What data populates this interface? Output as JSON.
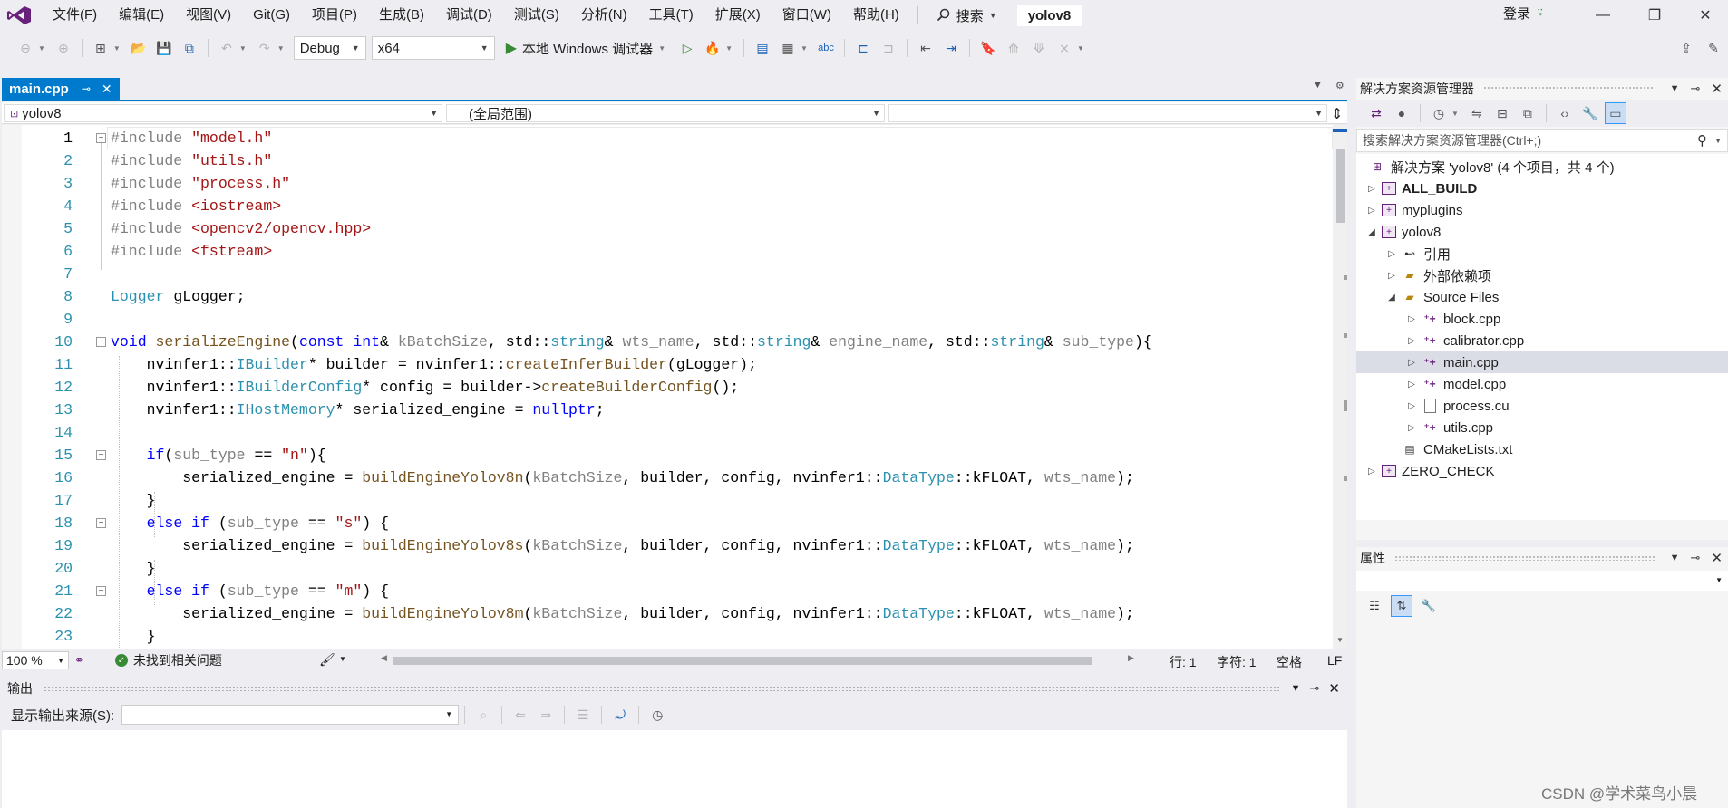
{
  "menubar": {
    "items": [
      "文件(F)",
      "编辑(E)",
      "视图(V)",
      "Git(G)",
      "项目(P)",
      "生成(B)",
      "调试(D)",
      "测试(S)",
      "分析(N)",
      "工具(T)",
      "扩展(X)",
      "窗口(W)",
      "帮助(H)"
    ],
    "search_label": "搜索",
    "project_name": "yolov8",
    "login_label": "登录"
  },
  "toolbar": {
    "configuration": "Debug",
    "platform": "x64",
    "run_label": "本地 Windows 调试器"
  },
  "editor": {
    "tab_label": "main.cpp",
    "nav_project": "yolov8",
    "nav_scope": "(全局范围)",
    "nav_member": "",
    "current_line": 1,
    "line_numbers": [
      "1",
      "2",
      "3",
      "4",
      "5",
      "6",
      "7",
      "8",
      "9",
      "10",
      "11",
      "12",
      "13",
      "14",
      "15",
      "16",
      "17",
      "18",
      "19",
      "20",
      "21",
      "22",
      "23"
    ]
  },
  "editor_status": {
    "zoom": "100 %",
    "issues": "未找到相关问题",
    "line": "行: 1",
    "char": "字符: 1",
    "indent": "空格",
    "eol": "LF"
  },
  "output": {
    "title": "输出",
    "source_label": "显示输出来源(S):",
    "source_value": ""
  },
  "solution_explorer": {
    "title": "解决方案资源管理器",
    "search_placeholder": "搜索解决方案资源管理器(Ctrl+;)",
    "solution_label": "解决方案 'yolov8' (4 个项目，共 4 个)",
    "projects": [
      "ALL_BUILD",
      "myplugins",
      "yolov8",
      "ZERO_CHECK"
    ],
    "references": "引用",
    "external_deps": "外部依赖项",
    "source_files_folder": "Source Files",
    "files": [
      "block.cpp",
      "calibrator.cpp",
      "main.cpp",
      "model.cpp",
      "process.cu",
      "utils.cpp"
    ],
    "cmake_file": "CMakeLists.txt",
    "selected_file": "main.cpp"
  },
  "properties": {
    "title": "属性"
  },
  "watermark": "CSDN @学术菜鸟小晨",
  "colors": {
    "accent": "#007acc",
    "keyword": "#0000ff",
    "string": "#a31515",
    "type": "#2b91af",
    "preprocessor": "#808080",
    "vs_purple": "#68217a"
  }
}
